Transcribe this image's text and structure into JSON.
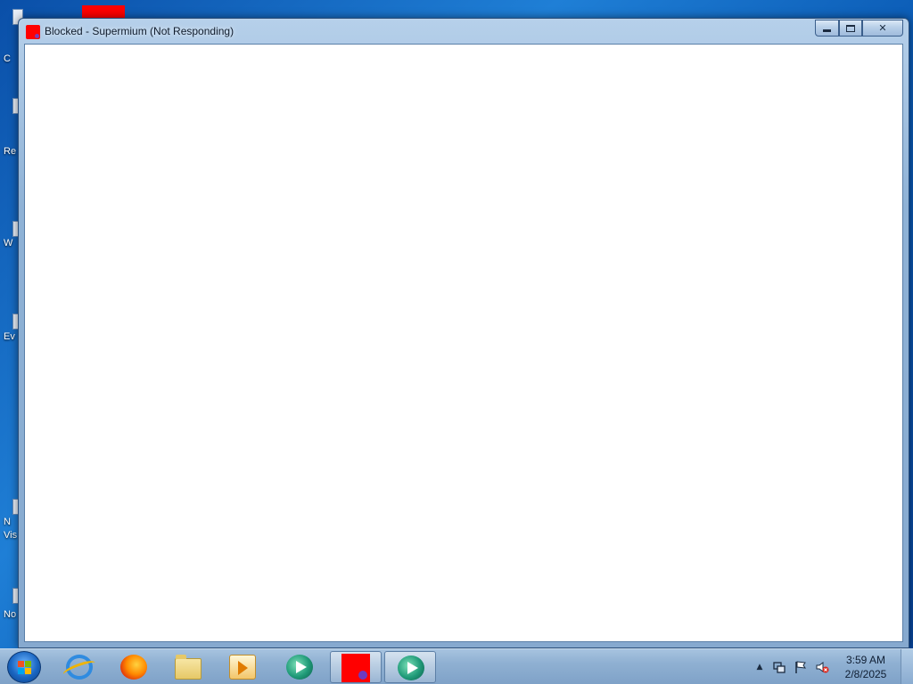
{
  "window": {
    "title": "Blocked - Supermium (Not Responding)",
    "minimize_glyph": "minimize",
    "maximize_glyph": "maximize",
    "close_label": "✕"
  },
  "desktop": {
    "icons": [
      {
        "label": "C",
        "icon": "desktop-icon"
      },
      {
        "label": "Re",
        "icon": "recycle-bin-icon"
      },
      {
        "label": "W",
        "icon": "shortcut-icon"
      },
      {
        "label": "Ev",
        "icon": "shortcut-icon"
      },
      {
        "label": "N",
        "icon": "shortcut-icon"
      },
      {
        "label": "Vis",
        "icon": "shortcut-icon"
      },
      {
        "label": "No",
        "icon": "shortcut-icon"
      }
    ],
    "red_square_color": "#ff0000"
  },
  "taskbar": {
    "start": {
      "icon": "windows-start-orb"
    },
    "pinned": [
      {
        "name": "internet-explorer",
        "icon": "ie-icon"
      },
      {
        "name": "firefox",
        "icon": "firefox-icon"
      },
      {
        "name": "windows-explorer",
        "icon": "folder-icon"
      },
      {
        "name": "media-player",
        "icon": "media-player-icon"
      },
      {
        "name": "app",
        "icon": "app-circle-icon"
      },
      {
        "name": "supermium",
        "icon": "red-square-icon"
      },
      {
        "name": "app-active",
        "icon": "app-circle-icon"
      }
    ],
    "tray": {
      "expand_label": "▲",
      "icons": [
        "network-icon",
        "action-center-flag-icon",
        "volume-muted-icon"
      ],
      "time": "3:59 AM",
      "date": "2/8/2025"
    }
  },
  "colors": {
    "accent": "#1f7fd6",
    "titlebar": "#b6d0ea",
    "red": "#ff0000"
  }
}
